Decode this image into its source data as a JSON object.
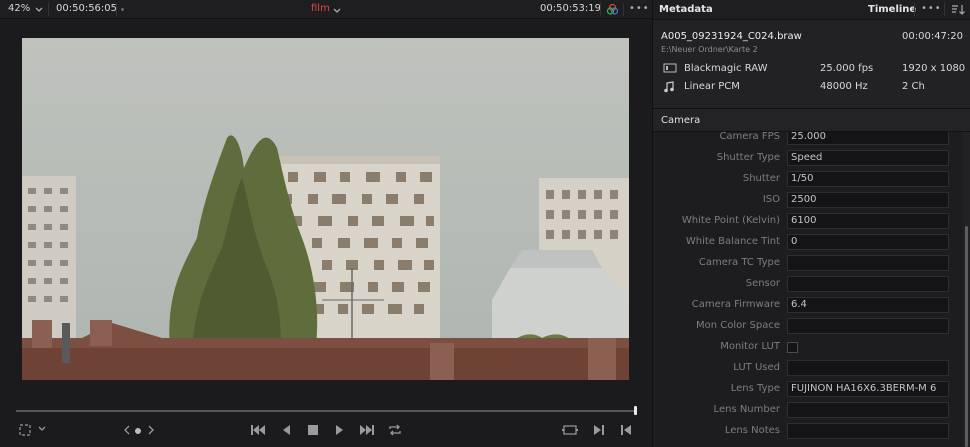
{
  "viewer": {
    "zoom": "42%",
    "timecode_left": "00:50:56:05",
    "clip_name": "film",
    "timecode_right": "00:50:53:19",
    "more": "•••"
  },
  "metadata_panel": {
    "title": "Metadata",
    "timeline_tab": "Timeline",
    "more": "•••",
    "clip": {
      "filename": "A005_09231924_C024.braw",
      "duration": "00:00:47:20",
      "path": "E:\\Neuer Ordner\\Karte 2",
      "video_codec": "Blackmagic RAW",
      "fps": "25.000 fps",
      "resolution": "1920 x 1080",
      "audio_codec": "Linear PCM",
      "sample_rate": "48000 Hz",
      "channels": "2 Ch"
    },
    "section": "Camera",
    "fields": [
      {
        "label": "Camera FPS",
        "value": "25.000"
      },
      {
        "label": "Shutter Type",
        "value": "Speed"
      },
      {
        "label": "Shutter",
        "value": "1/50"
      },
      {
        "label": "ISO",
        "value": "2500"
      },
      {
        "label": "White Point (Kelvin)",
        "value": "6100"
      },
      {
        "label": "White Balance Tint",
        "value": "0"
      },
      {
        "label": "Camera TC Type",
        "value": ""
      },
      {
        "label": "Sensor",
        "value": ""
      },
      {
        "label": "Camera Firmware",
        "value": "6.4"
      },
      {
        "label": "Mon Color Space",
        "value": ""
      },
      {
        "label": "Monitor LUT",
        "value": ""
      },
      {
        "label": "LUT Used",
        "value": ""
      },
      {
        "label": "Lens Type",
        "value": "FUJINON HA16X6.3BERM-M 6"
      },
      {
        "label": "Lens Number",
        "value": ""
      },
      {
        "label": "Lens Notes",
        "value": ""
      }
    ]
  },
  "colors": {
    "accent_red": "#e0473d",
    "panel_bg": "#222225",
    "field_bg": "#141416"
  },
  "icons": [
    "chevron-down-icon",
    "color-wheel-icon",
    "more-icon",
    "sort-icon",
    "film-icon",
    "music-note-icon",
    "crop-icon",
    "skip-start-icon",
    "play-reverse-icon",
    "stop-icon",
    "play-icon",
    "skip-end-icon",
    "loop-icon",
    "fit-icon",
    "prev-edit-icon",
    "next-edit-icon"
  ]
}
